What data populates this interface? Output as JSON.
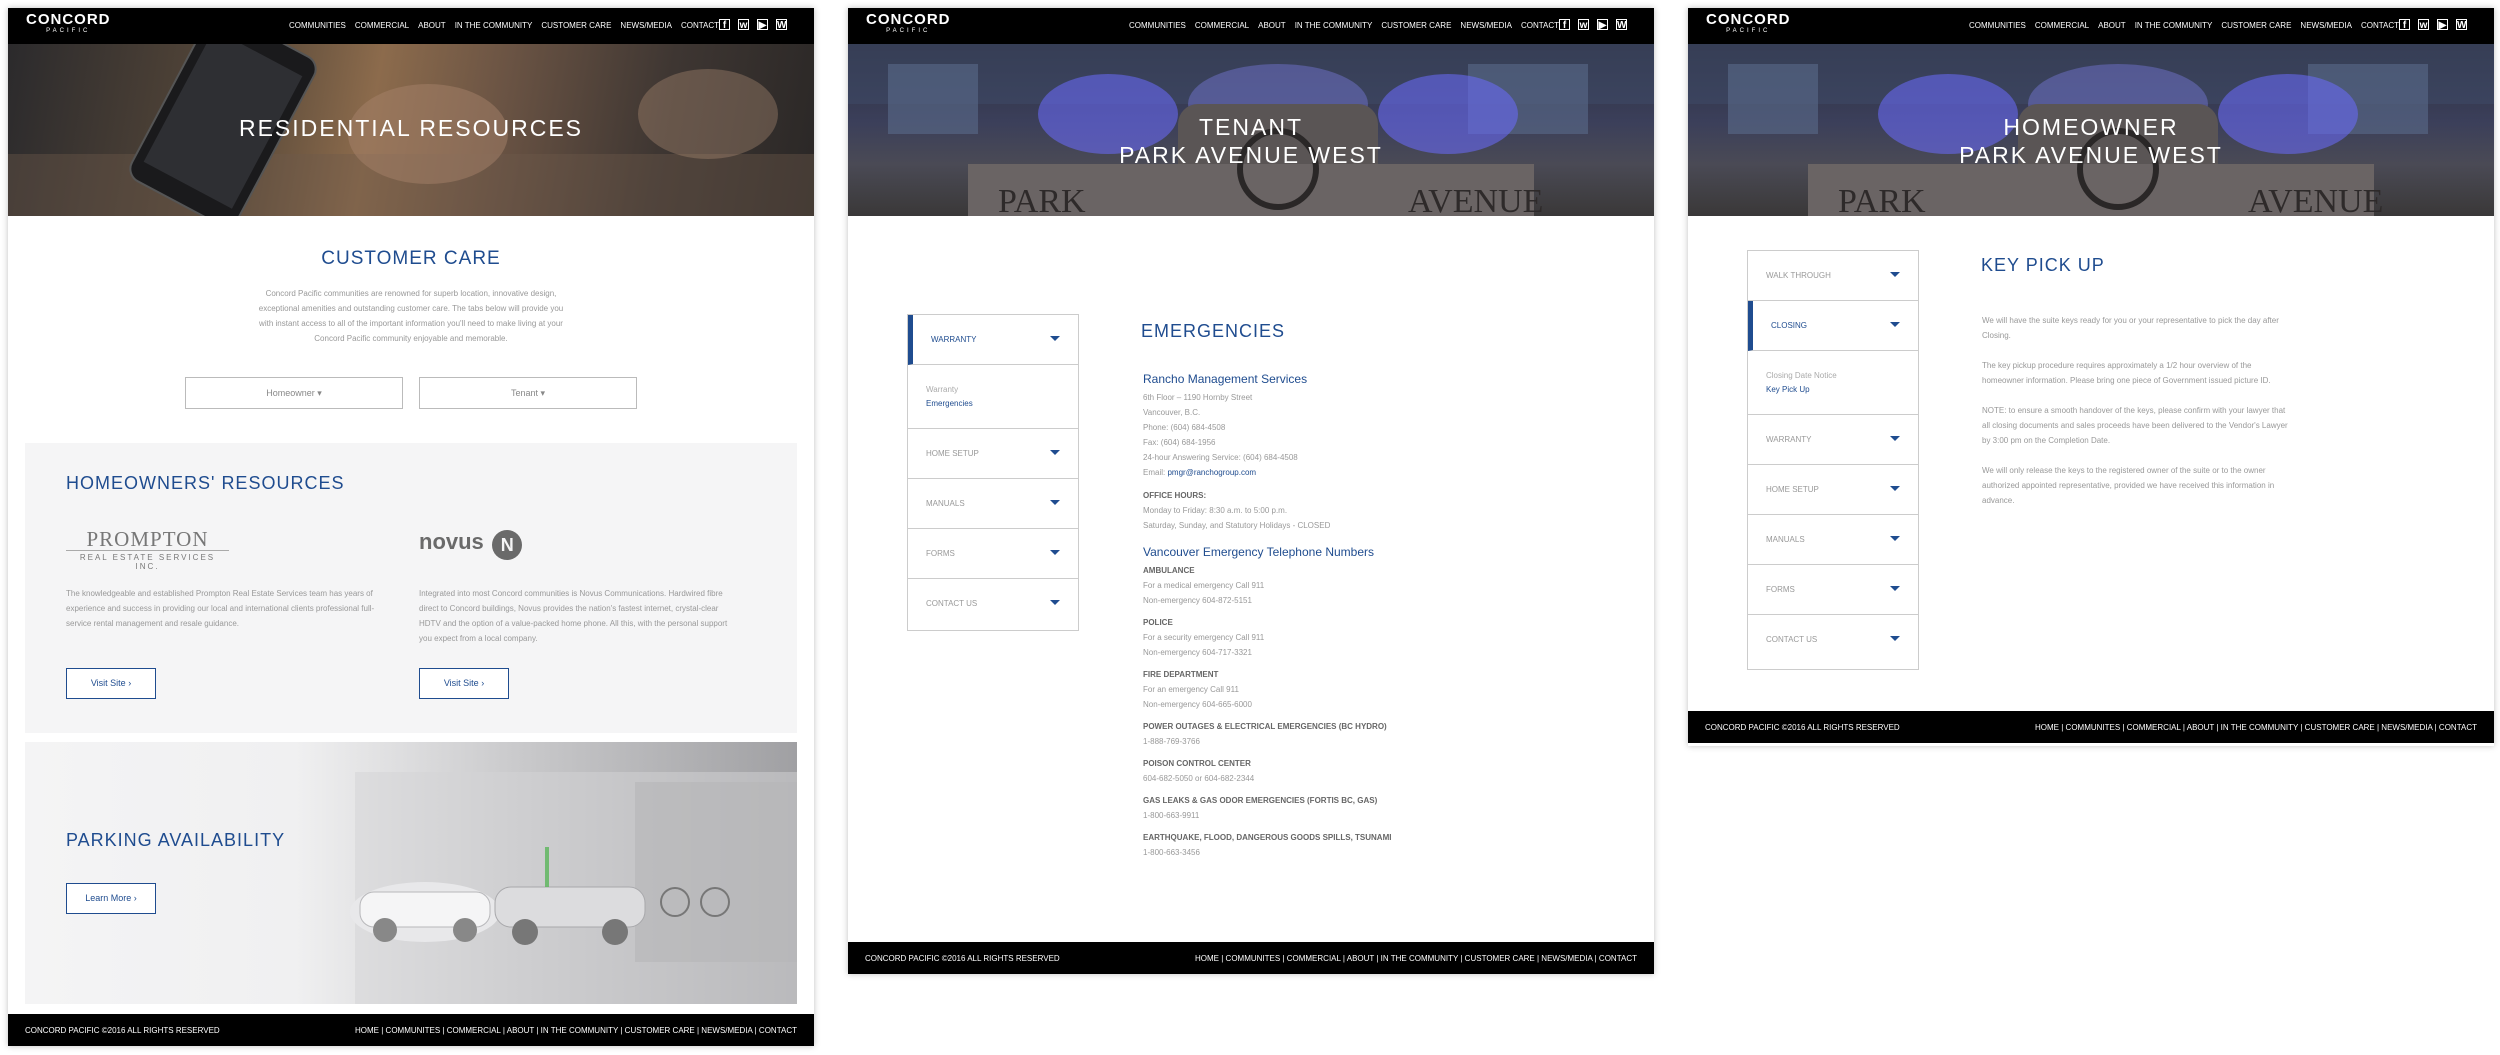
{
  "nav": {
    "logo": "CONCORD",
    "logo_sub": "PACIFIC",
    "items": [
      "COMMUNITIES",
      "COMMERCIAL",
      "ABOUT",
      "IN THE COMMUNITY",
      "CUSTOMER CARE",
      "NEWS/MEDIA",
      "CONTACT"
    ],
    "social": [
      "facebook-icon",
      "wechat-icon",
      "youtube-icon",
      "weibo-icon"
    ]
  },
  "footer": {
    "copy": "CONCORD PACIFIC ©2016 ALL RIGHTS RESERVED",
    "links": "HOME  |  COMMUNITES  |  COMMERCIAL  |  ABOUT  | IN THE COMMUNITY  |  CUSTOMER CARE  |  NEWS/MEDIA  |  CONTACT"
  },
  "panel1": {
    "hero_title": "RESIDENTIAL RESOURCES",
    "cc_title": "CUSTOMER CARE",
    "cc_text": [
      "Concord Pacific communities are renowned for superb location, innovative design,",
      "exceptional amenities and outstanding customer care. The tabs below will provide you",
      "with instant access to all of the important information you'll need to make living at your",
      "Concord Pacific community enjoyable and memorable."
    ],
    "dd_homeowner": "Homeowner",
    "dd_tenant": "Tenant",
    "hr_title": "HOMEOWNERS' RESOURCES",
    "prompton_logo": "PROMPTON",
    "prompton_sub": "REAL ESTATE SERVICES INC.",
    "novus_logo": "novus",
    "prompton_text": [
      "The knowledgeable and established Prompton Real Estate Services team has years of",
      "experience and success in providing our local and international clients professional full-",
      "service rental management and resale guidance."
    ],
    "novus_text": [
      "Integrated into most Concord communities is Novus Communications. Hardwired fibre",
      "direct to Concord buildings, Novus provides the nation's fastest internet, crystal-clear",
      "HDTV and the option of a value-packed home phone. All this, with the personal support",
      "you expect from a local company."
    ],
    "visit_site": "Visit Site",
    "parking_title": "PARKING AVAILABILITY",
    "learn_more": "Learn More"
  },
  "panel2": {
    "hero_line1": "TENANT",
    "hero_line2": "PARK AVENUE WEST",
    "sidebar": {
      "warranty": "WARRANTY",
      "sub_a": "Warranty",
      "sub_b": "Emergencies",
      "home_setup": "HOME SETUP",
      "manuals": "MANUALS",
      "forms": "FORMS",
      "contact": "CONTACT US"
    },
    "title": "EMERGENCIES",
    "rancho_title": "Rancho Management Services",
    "rancho_lines": [
      "6th Floor – 1190 Hornby Street",
      "Vancouver, B.C.",
      "Phone: (604) 684-4508",
      "Fax: (604) 684-1956",
      "24-hour Answering Service: (604) 684-4508"
    ],
    "email_label": "Email:",
    "email": "pmgr@ranchogroup.com",
    "office_hours_title": "OFFICE HOURS:",
    "office_hours": [
      "Monday to Friday: 8:30 a.m. to 5:00 p.m.",
      "Saturday, Sunday, and Statutory Holidays - CLOSED"
    ],
    "vet_title": "Vancouver Emergency Telephone Numbers",
    "groups": [
      {
        "t": "AMBULANCE",
        "l": [
          "For a medical emergency Call 911",
          "Non-emergency 604-872-5151"
        ]
      },
      {
        "t": "POLICE",
        "l": [
          "For a security emergency Call 911",
          "Non-emergency 604-717-3321"
        ]
      },
      {
        "t": "FIRE DEPARTMENT",
        "l": [
          "For an emergency Call 911",
          "Non-emergency 604-665-6000"
        ]
      },
      {
        "t": "POWER OUTAGES & ELECTRICAL EMERGENCIES (BC HYDRO)",
        "l": [
          "1-888-769-3766"
        ]
      },
      {
        "t": "POISON CONTROL CENTER",
        "l": [
          "604-682-5050 or 604-682-2344"
        ]
      },
      {
        "t": "GAS LEAKS & GAS ODOR EMERGENCIES (FORTIS BC, GAS)",
        "l": [
          "1-800-663-9911"
        ]
      },
      {
        "t": "EARTHQUAKE, FLOOD, DANGEROUS GOODS SPILLS, TSUNAMI",
        "l": [
          "1-800-663-3456"
        ]
      }
    ]
  },
  "panel3": {
    "hero_line1": "HOMEOWNER",
    "hero_line2": "PARK AVENUE WEST",
    "sidebar": {
      "walk": "WALK THROUGH",
      "closing": "CLOSING",
      "sub_a": "Closing Date Notice",
      "sub_b": "Key Pick Up",
      "warranty": "WARRANTY",
      "home_setup": "HOME SETUP",
      "manuals": "MANUALS",
      "forms": "FORMS",
      "contact": "CONTACT US"
    },
    "title": "KEY PICK UP",
    "paras": [
      [
        "We will have the suite keys ready for you or your representative to pick the day after",
        "Closing."
      ],
      [
        "The key pickup procedure requires approximately a 1/2 hour overview of the",
        "homeowner information. Please bring one piece of Government issued picture ID."
      ],
      [
        "NOTE: to ensure a smooth handover of the keys, please confirm with your lawyer that",
        "all closing documents and sales proceeds have been delivered to the Vendor's Lawyer",
        "by 3:00 pm on the Completion Date."
      ],
      [
        "We will only release the keys to the registered owner of the suite or to the owner",
        "authorized appointed representative, provided we have received this information in",
        "advance."
      ]
    ]
  }
}
